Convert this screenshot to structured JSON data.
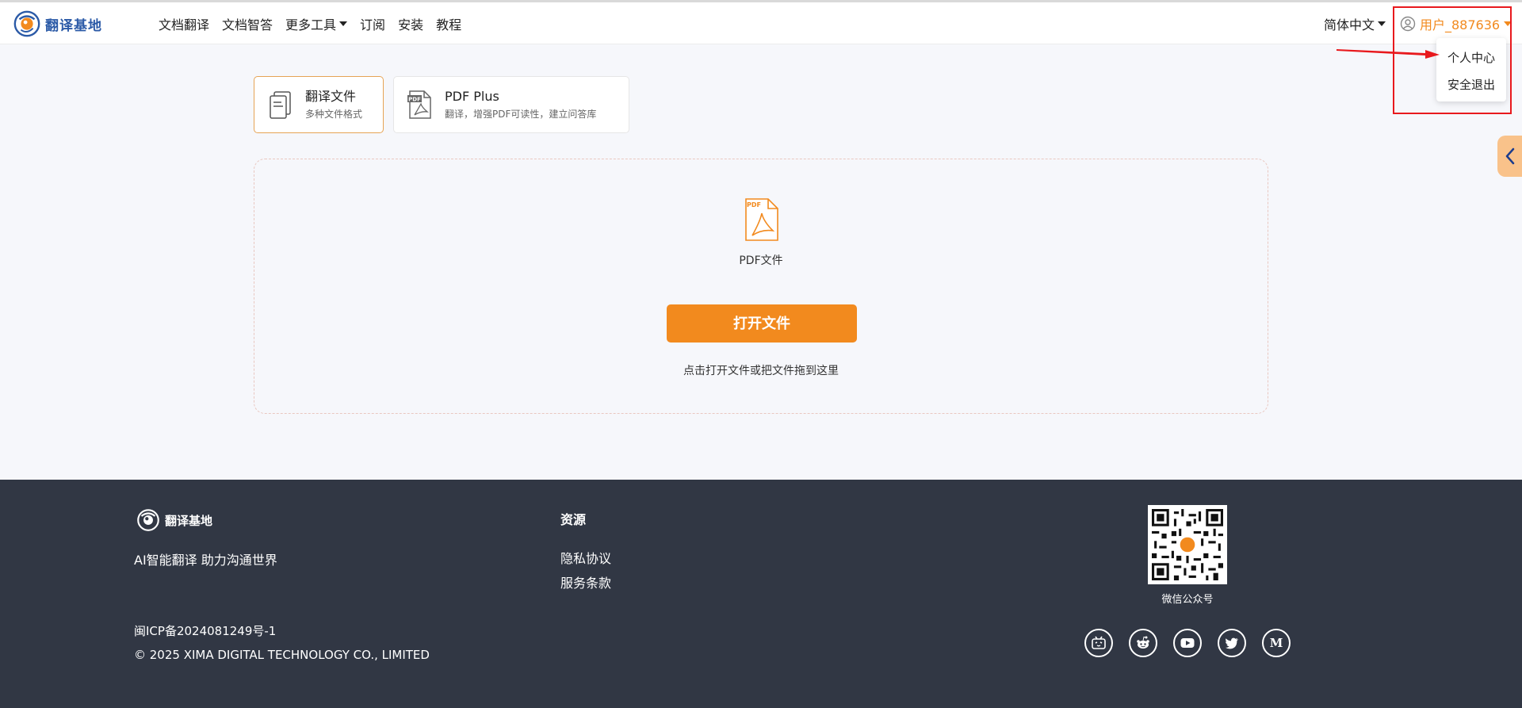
{
  "header": {
    "logo_text": "翻译基地",
    "nav": [
      {
        "label": "文档翻译"
      },
      {
        "label": "文档智答"
      },
      {
        "label": "更多工具"
      },
      {
        "label": "订阅"
      },
      {
        "label": "安装"
      },
      {
        "label": "教程"
      }
    ],
    "language": "简体中文",
    "user_name": "用户_887636"
  },
  "user_menu": {
    "items": [
      {
        "label": "个人中心"
      },
      {
        "label": "安全退出"
      }
    ]
  },
  "modes": [
    {
      "title": "翻译文件",
      "subtitle": "多种文件格式"
    },
    {
      "title": "PDF Plus",
      "subtitle": "翻译，增强PDF可读性，建立问答库"
    }
  ],
  "upload": {
    "file_type_label": "PDF文件",
    "open_button": "打开文件",
    "hint": "点击打开文件或把文件拖到这里"
  },
  "footer": {
    "logo_text": "翻译基地",
    "slogan": "AI智能翻译 助力沟通世界",
    "resources_title": "资源",
    "links": [
      {
        "label": "隐私协议"
      },
      {
        "label": "服务条款"
      }
    ],
    "icp": "闽ICP备2024081249号-1",
    "copyright": "© 2025 XIMA DIGITAL TECHNOLOGY CO., LIMITED",
    "qr_label": "微信公众号",
    "socials": [
      "bilibili-icon",
      "reddit-icon",
      "youtube-icon",
      "twitter-icon",
      "medium-icon"
    ]
  },
  "colors": {
    "accent": "#f28a1e",
    "brand_blue": "#2b5aa7",
    "footer_bg": "#313744",
    "annotation_red": "#e8191d"
  }
}
